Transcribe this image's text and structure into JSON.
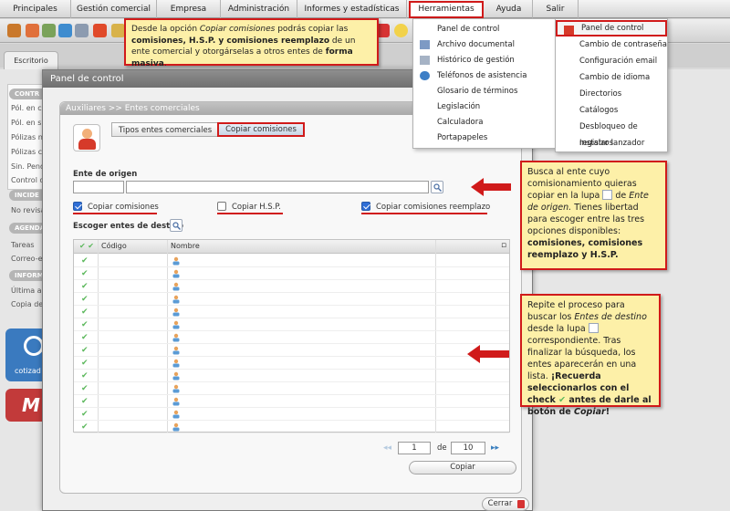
{
  "menubar": {
    "items": [
      "Principales",
      "Gestión comercial",
      "Empresa",
      "Administración",
      "Informes y estadísticas",
      "Herramientas",
      "Ayuda",
      "Salir"
    ]
  },
  "desktop": {
    "tab_label": "Escritorio",
    "side_heads": [
      "CONTR",
      "INCIDE",
      "AGENDA",
      "INFORM"
    ],
    "side_lines": [
      "Pól. en con",
      "Pól. en s",
      "Pólizas n",
      "Pólizas c",
      "Sin. Pend",
      "Control d",
      "No revisa",
      "Tareas",
      "Correo-e",
      "Última a",
      "Copia de"
    ],
    "tile_label": "cotizad"
  },
  "dialog": {
    "title": "Panel de control",
    "breadcrumb": "Auxiliares >> Entes comerciales",
    "tabs": [
      "Tipos entes comerciales",
      "Copiar comisiones"
    ],
    "origin_label": "Ente de origen",
    "origin_code": "",
    "origin_name": "",
    "checkboxes": [
      {
        "label": "Copiar comisiones",
        "checked": true
      },
      {
        "label": "Copiar H.S.P.",
        "checked": false
      },
      {
        "label": "Copiar comisiones reemplazo",
        "checked": true
      }
    ],
    "dest_label": "Escoger entes de destino",
    "grid": {
      "columns": [
        "Código",
        "Nombre"
      ],
      "row_count": 14
    },
    "pager": {
      "page": "1",
      "of_label": "de",
      "total": "10"
    },
    "copy_button": "Copiar",
    "close_button": "Cerrar"
  },
  "herramientas_menu": [
    "Panel de control",
    "Archivo documental",
    "Histórico de gestión",
    "Teléfonos de asistencia",
    "Glosario de términos",
    "Legislación",
    "Calculadora",
    "Portapapeles"
  ],
  "panel_submenu": [
    "Panel de control",
    "Cambio de contraseña",
    "Configuración email",
    "Cambio de idioma",
    "Directorios",
    "Catálogos",
    "Desbloqueo de registros",
    "Instalar lanzador"
  ],
  "callouts": {
    "top": {
      "t1": "Desde la opción ",
      "t2": "Copiar comisiones",
      "t3": " podrás copiar las ",
      "t4": "comisiones, H.S.P. y comisiones reemplazo",
      "t5": " de un ente comercial y otorgárselas a otros entes de ",
      "t6": "forma masiva",
      "t7": "."
    },
    "middle": {
      "t1": "Busca al ente cuyo comisionamiento quieras copiar en la lupa ",
      "t2": " de ",
      "t3": "Ente de origen.",
      "t4": " Tienes libertad para escoger entre las tres opciones disponibles: ",
      "t5": "comisiones, comisiones reemplazo y H.S.P."
    },
    "bottom": {
      "t1": "Repite el proceso para buscar los ",
      "t2": "Entes de destino",
      "t3": " desde la lupa ",
      "t4": " correspondiente. Tras finalizar la búsqueda, los entes aparecerán en una lista. ",
      "t5": "¡Recuerda seleccionarlos con el check ",
      "t6": " antes de darle al botón de ",
      "t7": "Copiar",
      "t8": "!"
    }
  },
  "colors": {
    "highlight": "#d01a1a",
    "callout_bg": "#fdf0a8",
    "check_blue": "#2f6fd6"
  }
}
